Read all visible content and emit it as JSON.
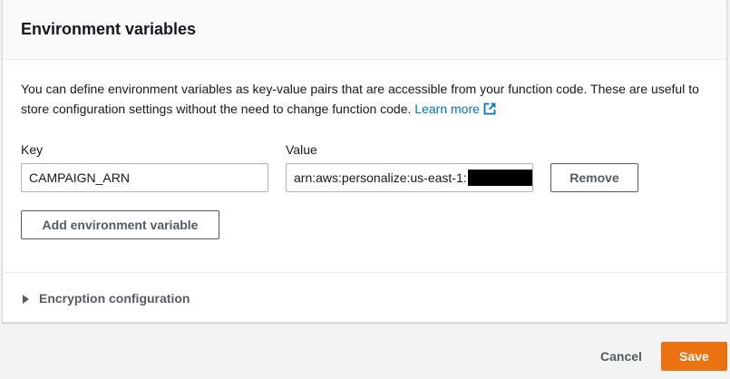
{
  "panel": {
    "title": "Environment variables",
    "description": "You can define environment variables as key-value pairs that are accessible from your function code. These are useful to store configuration settings without the need to change function code.",
    "learn_more": "Learn more",
    "learn_more_icon": "external-link-icon"
  },
  "variables": {
    "key_label": "Key",
    "value_label": "Value",
    "items": [
      {
        "key": "CAMPAIGN_ARN",
        "value": "arn:aws:personalize:us-east-1:"
      }
    ],
    "remove_label": "Remove",
    "add_label": "Add environment variable"
  },
  "encryption": {
    "label": "Encryption configuration",
    "expanded": false
  },
  "footer": {
    "cancel_label": "Cancel",
    "save_label": "Save"
  },
  "colors": {
    "accent": "#ec7211",
    "link": "#0073bb",
    "border": "#aab7b8"
  }
}
